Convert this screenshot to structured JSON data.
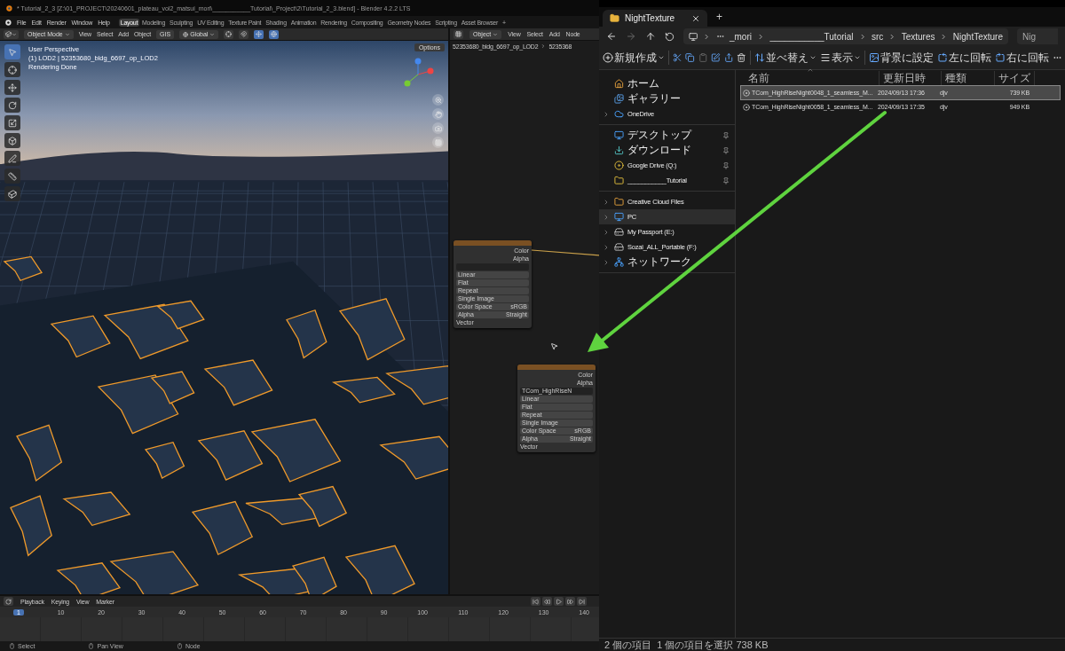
{
  "blender": {
    "title": "* Tutorial_2_3 [Z:\\01_PROJECT\\20240601_plateau_vol2_matsui_mori\\___________Tutorial\\_Project\\2\\Tutorial_2_3.blend] - Blender 4.2.2 LTS",
    "menu": [
      "File",
      "Edit",
      "Render",
      "Window",
      "Help"
    ],
    "workspaces": [
      {
        "label": "Layout",
        "selected": true
      },
      {
        "label": "Modeling",
        "selected": false
      },
      {
        "label": "Sculpting",
        "selected": false
      },
      {
        "label": "UV Editing",
        "selected": false
      },
      {
        "label": "Texture Paint",
        "selected": false
      },
      {
        "label": "Shading",
        "selected": false
      },
      {
        "label": "Animation",
        "selected": false
      },
      {
        "label": "Rendering",
        "selected": false
      },
      {
        "label": "Compositing",
        "selected": false
      },
      {
        "label": "Geometry Nodes",
        "selected": false
      },
      {
        "label": "Scripting",
        "selected": false
      },
      {
        "label": "Asset Browser",
        "selected": false
      }
    ],
    "add_workspace": "+",
    "viewport": {
      "mode": "Object Mode",
      "menus": [
        "View",
        "Select",
        "Add",
        "Object"
      ],
      "gis": "GIS",
      "orientation": "Global",
      "options": "Options",
      "overlay_lines": [
        "User Perspective",
        "(1) LOD2 | 52353680_bldg_6697_op_LOD2",
        "Rendering Done"
      ]
    },
    "node_editor": {
      "object": "Object",
      "menus": [
        "View",
        "Select",
        "Add",
        "Node"
      ],
      "breadcrumbs": [
        "52353680_bldg_6697_op_LOD2",
        "5235368"
      ],
      "nodes": [
        {
          "linked": true,
          "outputs": [
            "Color",
            "Alpha"
          ],
          "dropdowns": [
            "Linear",
            "Flat",
            "Repeat",
            "Single Image"
          ],
          "settings": [
            {
              "label": "Color Space",
              "value": "sRGB"
            },
            {
              "label": "Alpha",
              "value": "Straight"
            }
          ],
          "input": "Vector"
        },
        {
          "linked": false,
          "image": "TCom_HighRiseN",
          "outputs": [
            "Color",
            "Alpha"
          ],
          "dropdowns": [
            "Linear",
            "Flat",
            "Repeat",
            "Single Image"
          ],
          "settings": [
            {
              "label": "Color Space",
              "value": "sRGB"
            },
            {
              "label": "Alpha",
              "value": "Straight"
            }
          ],
          "input": "Vector"
        }
      ]
    },
    "timeline": {
      "menus": [
        "Playback",
        "Keying",
        "View",
        "Marker"
      ],
      "current_frame": "1",
      "frames": [
        "10",
        "20",
        "30",
        "40",
        "50",
        "60",
        "70",
        "80",
        "90",
        "100",
        "110",
        "120",
        "130",
        "140"
      ]
    },
    "status": [
      "Select",
      "Pan View",
      "Node"
    ]
  },
  "explorer": {
    "tabs": [
      {
        "label": "NightTexture",
        "selected": true
      }
    ],
    "new_tab": "+",
    "path": [
      "_mori",
      "___________Tutorial",
      "src",
      "Textures",
      "NightTexture"
    ],
    "search": "Nig",
    "new_button": "新規作成",
    "sort_button": "並べ替え",
    "view_button": "表示",
    "actions": [
      "背景に設定",
      "左に回転",
      "右に回転"
    ],
    "sidebar": [
      [
        {
          "label": "ホーム",
          "expandable": false,
          "pinned": false,
          "selected": false
        },
        {
          "label": "ギャラリー",
          "expandable": false,
          "pinned": false,
          "selected": false
        },
        {
          "label": "OneDrive",
          "expandable": true,
          "pinned": false,
          "selected": false
        }
      ],
      [
        {
          "label": "デスクトップ",
          "expandable": false,
          "pinned": true,
          "selected": false
        },
        {
          "label": "ダウンロード",
          "expandable": false,
          "pinned": true,
          "selected": false
        },
        {
          "label": "Google Drive (Q:)",
          "expandable": false,
          "pinned": true,
          "selected": false
        },
        {
          "label": "___________Tutorial",
          "expandable": false,
          "pinned": true,
          "selected": false
        }
      ],
      [
        {
          "label": "Creative Cloud Files",
          "expandable": true,
          "pinned": false,
          "selected": false
        },
        {
          "label": "PC",
          "expandable": true,
          "pinned": false,
          "selected": true
        },
        {
          "label": "My Passport (E:)",
          "expandable": true,
          "pinned": false,
          "selected": false
        },
        {
          "label": "Sozai_ALL_Portable (F:)",
          "expandable": true,
          "pinned": false,
          "selected": false
        },
        {
          "label": "ネットワーク",
          "expandable": true,
          "pinned": false,
          "selected": false
        }
      ]
    ],
    "columns": [
      "名前",
      "更新日時",
      "種類",
      "サイズ"
    ],
    "rows": [
      {
        "name": "TCom_HighRiseNight0048_1_seamless_M...",
        "date": "2024/09/13 17:36",
        "type": "djv",
        "size": "739 KB",
        "selected": true
      },
      {
        "name": "TCom_HighRiseNight0058_1_seamless_M...",
        "date": "2024/09/13 17:35",
        "type": "djv",
        "size": "949 KB",
        "selected": false
      }
    ],
    "status": [
      "2 個の項目",
      "1 個の項目を選択 738 KB"
    ]
  }
}
